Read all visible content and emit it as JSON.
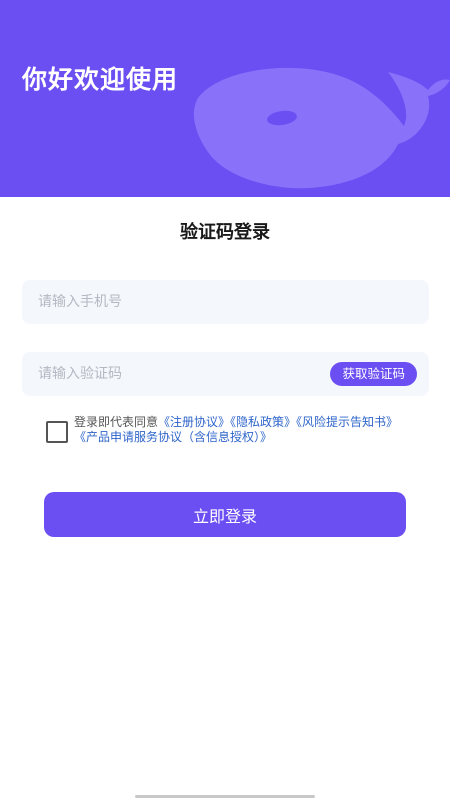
{
  "header": {
    "greeting": "你好欢迎使用",
    "background_color": "#6b4ff2",
    "illustration_icon": "whale-icon"
  },
  "login": {
    "title": "验证码登录",
    "phone_placeholder": "请输入手机号",
    "code_placeholder": "请输入验证码",
    "get_code_label": "获取验证码",
    "submit_label": "立即登录"
  },
  "agreement": {
    "checked": false,
    "prefix": "登录即代表同意",
    "links": [
      "《注册协议》",
      "《隐私政策》",
      "《风险提示告知书》",
      "《产品申请服务协议（含信息授权）》"
    ]
  },
  "colors": {
    "accent": "#6b4ff2",
    "link": "#2f65c9",
    "field_bg": "#f4f7fb"
  }
}
